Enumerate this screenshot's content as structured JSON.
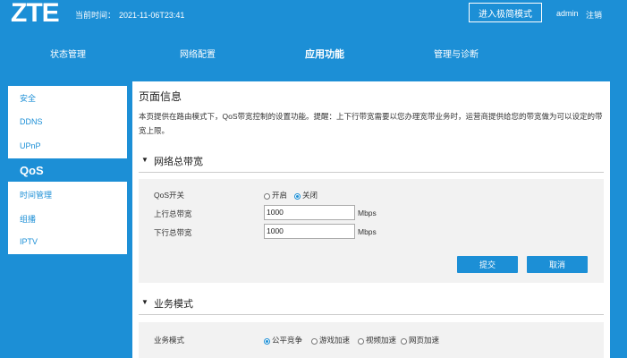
{
  "header": {
    "logo": "ZTE",
    "time_label": "当前时间：",
    "time_value": "2021-11-06T23:41",
    "simple_mode": "进入极简模式",
    "user": "admin",
    "logout": "注销"
  },
  "nav": {
    "items": [
      "状态管理",
      "网络配置",
      "应用功能",
      "管理与诊断"
    ],
    "active": "应用功能"
  },
  "sidebar": {
    "items": [
      "安全",
      "DDNS",
      "UPnP",
      "QoS",
      "时间管理",
      "组播",
      "IPTV"
    ],
    "active": "QoS"
  },
  "page": {
    "title": "页面信息",
    "description": "本页提供在路由模式下，QoS带宽控制的设置功能。提醒：上下行带宽需要以您办理宽带业务时，运营商提供给您的带宽做为可以设定的带宽上限。"
  },
  "bandwidth": {
    "title": "网络总带宽",
    "qos_label": "QoS开关",
    "on_label": "开启",
    "off_label": "关闭",
    "qos_state": "off",
    "upload_label": "上行总带宽",
    "upload_value": "1000",
    "download_label": "下行总带宽",
    "download_value": "1000",
    "unit": "Mbps",
    "submit": "提交",
    "cancel": "取消"
  },
  "service": {
    "title": "业务模式",
    "label": "业务模式",
    "options": [
      "公平竞争",
      "游戏加速",
      "视频加速",
      "网页加速"
    ],
    "selected": "公平竞争"
  }
}
